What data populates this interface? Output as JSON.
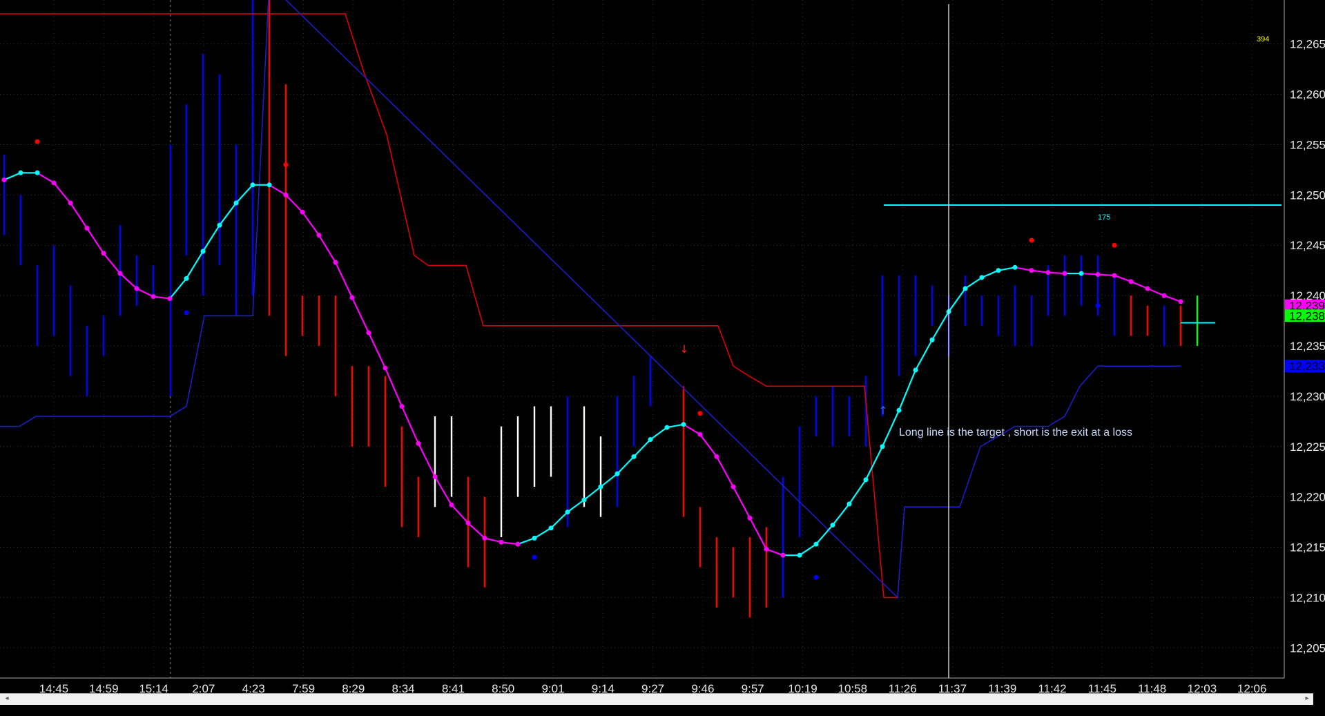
{
  "window": {
    "credit": "Created with TradeStation. ©TradeStation Technologies, Inc. All rights reserved."
  },
  "chart_data": {
    "type": "line",
    "title": "",
    "ylim": [
      12202,
      12268
    ],
    "y_ticks": [
      12205,
      12210,
      12215,
      12220,
      12225,
      12230,
      12235,
      12240,
      12245,
      12250,
      12255,
      12260,
      12265
    ],
    "y_tick_labels": [
      "12,205",
      "12,210",
      "12,215",
      "12,220",
      "12,225",
      "12,230",
      "12,235",
      "12,240",
      "12,245",
      "12,250",
      "12,255",
      "12,260",
      "12,265"
    ],
    "x_tick_labels": [
      "14:45",
      "14:59",
      "15:14",
      "2:07",
      "4:23",
      "7:59",
      "8:29",
      "8:34",
      "8:41",
      "8:50",
      "9:01",
      "9:14",
      "9:27",
      "9:46",
      "9:57",
      "10:19",
      "10:58",
      "11:26",
      "11:37",
      "11:39",
      "11:42",
      "11:45",
      "11:48",
      "12:03",
      "12:06"
    ],
    "price_markers": [
      {
        "label": "12,239",
        "value": 12239,
        "color": "#ff00ff"
      },
      {
        "label": "12,238",
        "value": 12238,
        "color": "#00ff00"
      },
      {
        "label": "12,233",
        "value": 12233,
        "color": "#0000ff"
      }
    ],
    "annotations": [
      {
        "text": "394",
        "color": "#ffff00"
      },
      {
        "text": "175",
        "color": "#00ffff"
      },
      {
        "text": "Long line  is the  target , short is the exit at a loss",
        "color": "#c8dcff"
      }
    ],
    "target_line": {
      "value": 12249,
      "color": "#00ffff"
    },
    "exit_line": {
      "value": 12237.3,
      "color": "#00ffff"
    },
    "series": [
      {
        "kind": "moving_average",
        "values": [
          12251.5,
          12252.2,
          12252.2,
          12251.2,
          12249.2,
          12246.7,
          12244.2,
          12242.2,
          12240.7,
          12239.9,
          12239.7,
          12241.7,
          12244.4,
          12247.0,
          12249.2,
          12251.0,
          12251.0,
          12250.0,
          12248.3,
          12246.0,
          12243.3,
          12239.8,
          12236.3,
          12232.8,
          12229.0,
          12225.3,
          12222.0,
          12219.2,
          12217.4,
          12215.9,
          12215.5,
          12215.3,
          12215.9,
          12216.9,
          12218.5,
          12219.7,
          12221.0,
          12222.3,
          12224.0,
          12225.7,
          12226.9,
          12227.2,
          12226.2,
          12224.0,
          12221.0,
          12217.9,
          12214.8,
          12214.2,
          12214.2,
          12215.3,
          12217.2,
          12219.3,
          12221.7,
          12225.0,
          12228.6,
          12232.6,
          12235.6,
          12238.4,
          12240.7,
          12241.8,
          12242.5,
          12242.8,
          12242.5,
          12242.3,
          12242.2,
          12242.2,
          12242.1,
          12242.0,
          12241.4,
          12240.7,
          12240.0,
          12239.4
        ],
        "colors_up": "#00ffff",
        "colors_down": "#ff00ff"
      }
    ]
  }
}
